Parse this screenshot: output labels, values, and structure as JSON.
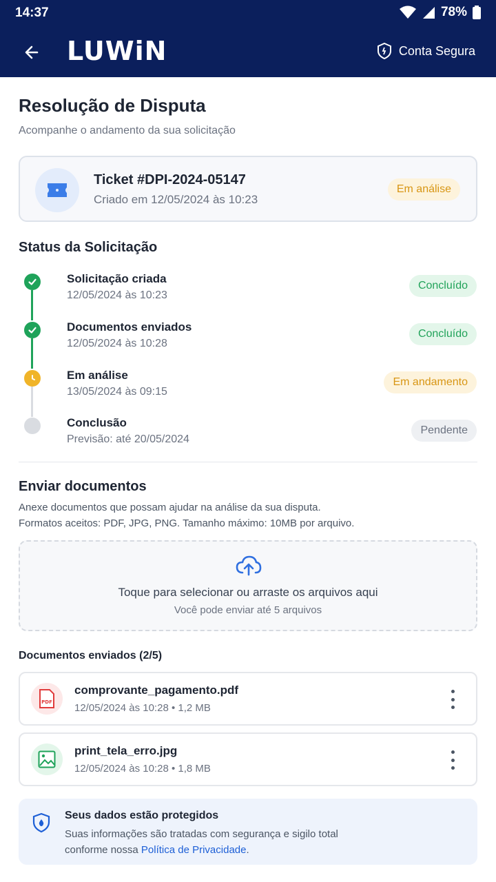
{
  "status_bar": {
    "time": "14:37",
    "battery": "78%"
  },
  "app_bar": {
    "logo": "LUWiN",
    "secure_label": "Conta Segura"
  },
  "page": {
    "title": "Resolução de Disputa",
    "subtitle": "Acompanhe o andamento da sua solicitação"
  },
  "ticket": {
    "title": "Ticket #DPI-2024-05147",
    "created": "Criado em 12/05/2024 às 10:23",
    "status": "Em análise"
  },
  "status_section": {
    "title": "Status da Solicitação",
    "steps": [
      {
        "name": "Solicitação criada",
        "date": "12/05/2024 às 10:23",
        "badge": "Concluído",
        "state": "done"
      },
      {
        "name": "Documentos enviados",
        "date": "12/05/2024 às 10:28",
        "badge": "Concluído",
        "state": "done"
      },
      {
        "name": "Em análise",
        "date": "13/05/2024 às 09:15",
        "badge": "Em andamento",
        "state": "active"
      },
      {
        "name": "Conclusão",
        "date": "Previsão: até 20/05/2024",
        "badge": "Pendente",
        "state": "pending"
      }
    ]
  },
  "upload": {
    "title": "Enviar documentos",
    "desc_line1": "Anexe documentos que possam ajudar na análise da sua disputa.",
    "desc_line2": "Formatos aceitos: PDF, JPG, PNG. Tamanho máximo: 10MB por arquivo.",
    "drop_main": "Toque para selecionar ou arraste os arquivos aqui",
    "drop_sub": "Você pode enviar até 5 arquivos"
  },
  "documents": {
    "title": "Documentos enviados (2/5)",
    "files": [
      {
        "name": "comprovante_pagamento.pdf",
        "meta": "12/05/2024 às 10:28 • 1,2 MB",
        "icon": "pdf-file-icon"
      },
      {
        "name": "print_tela_erro.jpg",
        "meta": "12/05/2024 às 10:28 • 1,8 MB",
        "icon": "image-file-icon"
      }
    ]
  },
  "privacy": {
    "title": "Seus dados estão protegidos",
    "text_line1": "Suas informações são tratadas com segurança e sigilo total",
    "text_line2_prefix": "conforme nossa ",
    "link": "Política de Privacidade",
    "text_line2_suffix": "."
  },
  "colors": {
    "header": "#0b1f5c",
    "done": "#1fa35a",
    "active": "#f0b429",
    "pending": "#d9dce1",
    "link": "#1d5fd6"
  }
}
